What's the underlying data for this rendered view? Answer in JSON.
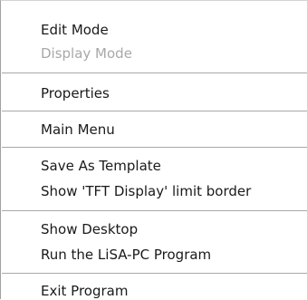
{
  "context_menu": {
    "items": [
      {
        "label": "Edit Mode",
        "enabled": true
      },
      {
        "label": "Display Mode",
        "enabled": false
      },
      {
        "label": "Properties",
        "enabled": true
      },
      {
        "label": "Main Menu",
        "enabled": true
      },
      {
        "label": "Save As Template",
        "enabled": true
      },
      {
        "label": "Show 'TFT Display' limit border",
        "enabled": true
      },
      {
        "label": "Show Desktop",
        "enabled": true
      },
      {
        "label": "Run the LiSA-PC Program",
        "enabled": true
      },
      {
        "label": "Exit Program",
        "enabled": true
      }
    ],
    "colors": {
      "text": "#1a1a1a",
      "disabled_text": "#a8a8a8",
      "separator": "#a8a8a8",
      "background": "#ffffff"
    }
  }
}
